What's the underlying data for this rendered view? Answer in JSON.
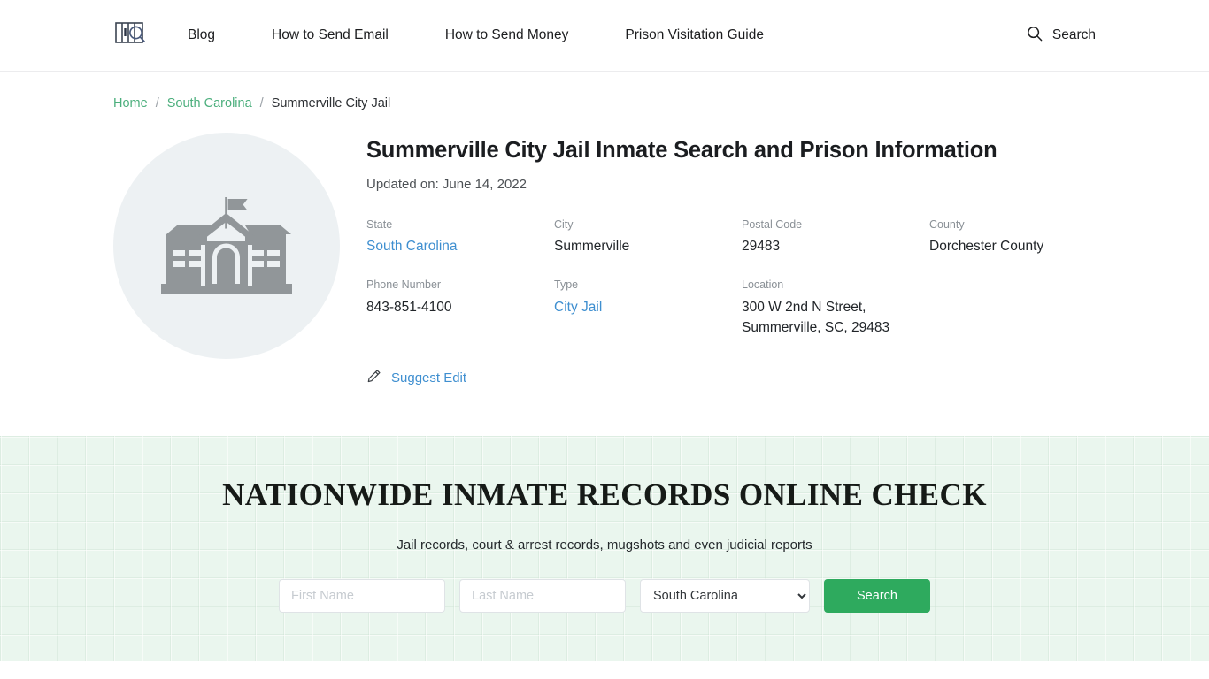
{
  "header": {
    "logo_name": "prison-bars-search-logo",
    "nav": [
      {
        "label": "Blog"
      },
      {
        "label": "How to Send Email"
      },
      {
        "label": "How to Send Money"
      },
      {
        "label": "Prison Visitation Guide"
      }
    ],
    "search_label": "Search"
  },
  "breadcrumb": {
    "items": [
      {
        "label": "Home",
        "link": true
      },
      {
        "label": "South Carolina",
        "link": true
      },
      {
        "label": "Summerville City Jail",
        "link": false
      }
    ],
    "separator": "/"
  },
  "facility": {
    "thumbnail_icon": "government-building-icon",
    "title": "Summerville City Jail Inmate Search and Prison Information",
    "updated": "Updated on: June 14, 2022",
    "fields": [
      {
        "label": "State",
        "value": "South Carolina",
        "link": true
      },
      {
        "label": "City",
        "value": "Summerville",
        "link": false
      },
      {
        "label": "Postal Code",
        "value": "29483",
        "link": false
      },
      {
        "label": "County",
        "value": "Dorchester County",
        "link": false
      },
      {
        "label": "Phone Number",
        "value": "843-851-4100",
        "link": false
      },
      {
        "label": "Type",
        "value": "City Jail",
        "link": true
      },
      {
        "label": "Location",
        "value": "300 W 2nd N Street, Summerville, SC, 29483",
        "link": false
      }
    ],
    "suggest_edit_label": "Suggest Edit"
  },
  "promo": {
    "title": "NATIONWIDE INMATE RECORDS ONLINE CHECK",
    "subtitle": "Jail records, court & arrest records, mugshots and even judicial reports",
    "first_name_placeholder": "First Name",
    "first_name_value": "",
    "last_name_placeholder": "Last Name",
    "last_name_value": "",
    "state_selected": "South Carolina",
    "state_options": [
      "South Carolina"
    ],
    "search_button": "Search"
  },
  "colors": {
    "brand_green": "#2eaa5e",
    "link_blue": "#3f8fd0",
    "breadcrumb_green": "#4caf7d",
    "promo_bg": "#eaf6ee",
    "thumb_bg": "#edf1f3"
  }
}
